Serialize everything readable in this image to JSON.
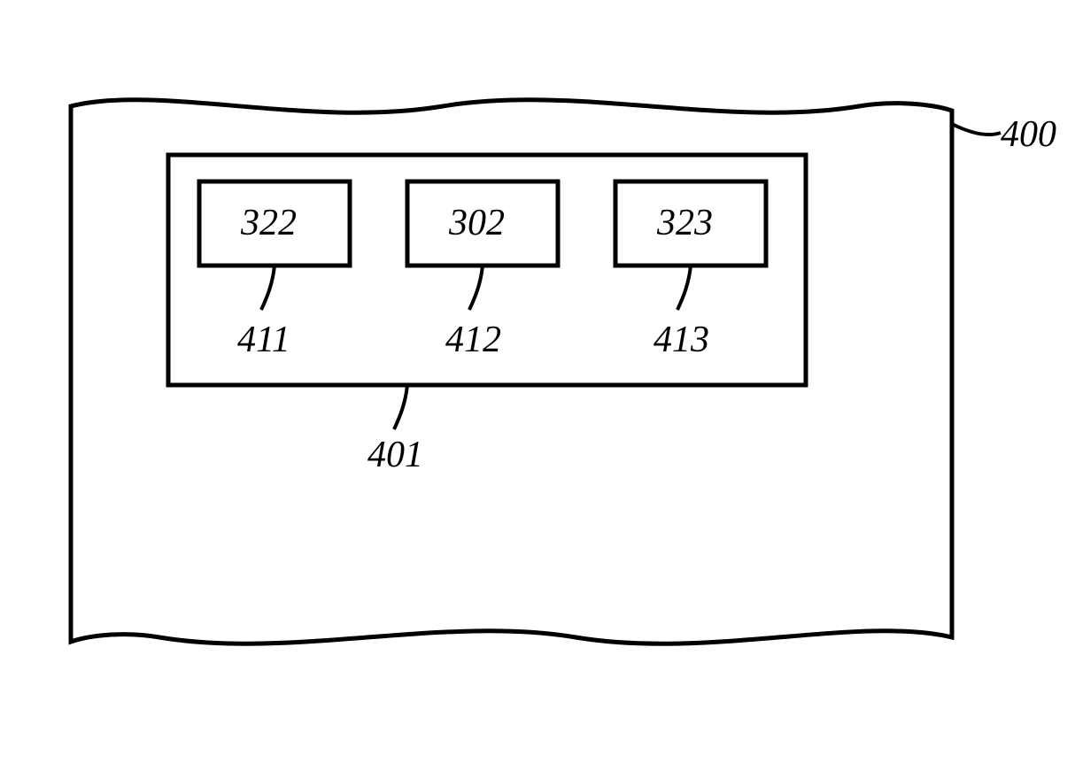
{
  "diagram": {
    "outer_ref": "400",
    "container_ref": "401",
    "boxes": [
      {
        "value": "322",
        "ref": "411"
      },
      {
        "value": "302",
        "ref": "412"
      },
      {
        "value": "323",
        "ref": "413"
      }
    ]
  }
}
